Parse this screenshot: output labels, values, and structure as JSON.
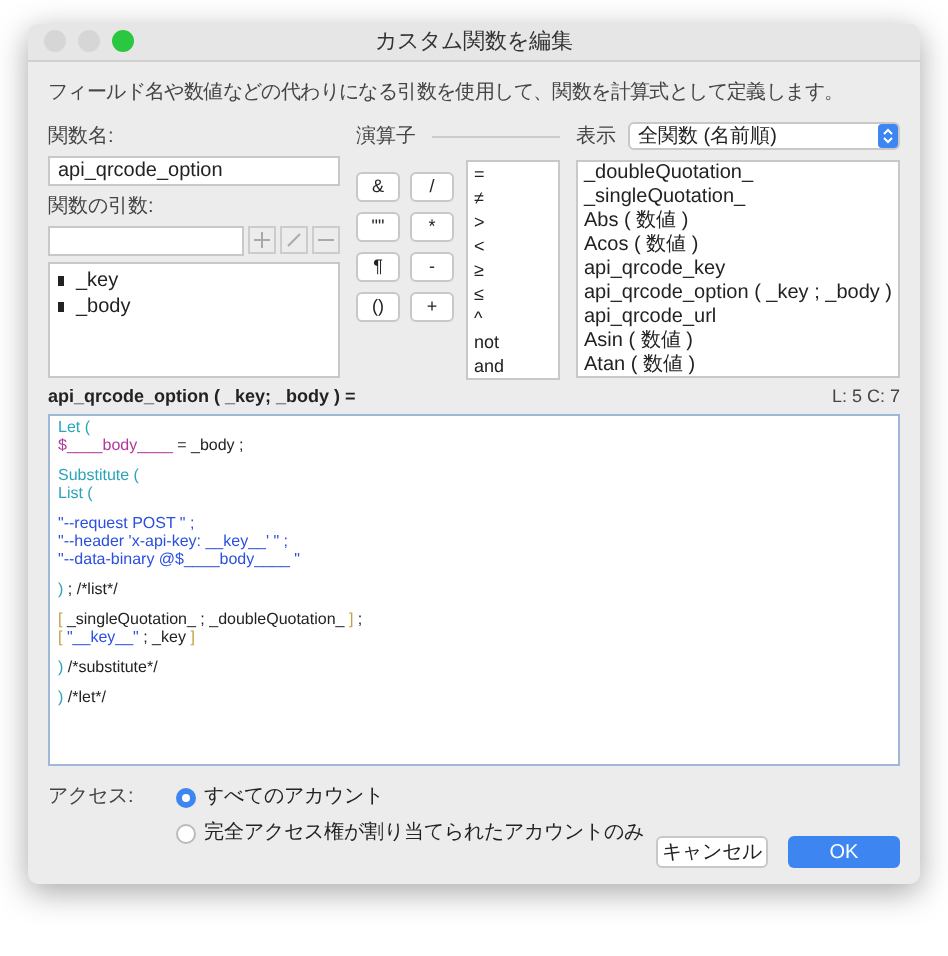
{
  "window": {
    "title": "カスタム関数を編集"
  },
  "description": "フィールド名や数値などの代わりになる引数を使用して、関数を計算式として定義します。",
  "function_name": {
    "label": "関数名:",
    "value": "api_qrcode_option"
  },
  "parameters": {
    "label": "関数の引数:",
    "items": [
      {
        "name": "_key"
      },
      {
        "name": "_body"
      }
    ]
  },
  "operators": {
    "label": "演算子",
    "buttons": [
      "&",
      "/",
      "\"\"",
      "*",
      "¶",
      "-",
      "()",
      "+"
    ],
    "list": [
      "=",
      "≠",
      ">",
      "<",
      "≥",
      "≤",
      "^",
      "not",
      "and"
    ]
  },
  "functions": {
    "label": "表示",
    "filter": "全関数 (名前順)",
    "items": [
      {
        "text": "_doubleQuotation_"
      },
      {
        "text": "_singleQuotation_"
      },
      {
        "text": "Abs ( 数値 )"
      },
      {
        "text": "Acos ( 数値 )"
      },
      {
        "text": "api_qrcode_key"
      },
      {
        "text": "api_qrcode_option ( _key ; _body )"
      },
      {
        "text": "api_qrcode_url"
      },
      {
        "text": "Asin ( 数値 )"
      },
      {
        "text": "Atan ( 数値 )"
      }
    ]
  },
  "editor": {
    "signature": "api_qrcode_option ( _key; _body ) =",
    "position": "L: 5 C: 7",
    "lines": [
      {
        "kind": "code",
        "tokens": [
          {
            "kind": "keyword",
            "text": "Let ("
          }
        ]
      },
      {
        "kind": "code",
        "tokens": [
          {
            "kind": "variable",
            "text": "$____body____"
          },
          {
            "kind": "plain",
            "text": " = _body ;"
          }
        ]
      },
      {
        "kind": "blank"
      },
      {
        "kind": "code",
        "tokens": [
          {
            "kind": "keyword",
            "text": "Substitute ("
          }
        ]
      },
      {
        "kind": "code",
        "tokens": [
          {
            "kind": "keyword",
            "text": "List ("
          }
        ]
      },
      {
        "kind": "blank"
      },
      {
        "kind": "code",
        "tokens": [
          {
            "kind": "string",
            "text": "\"--request POST \" ;"
          }
        ]
      },
      {
        "kind": "code",
        "tokens": [
          {
            "kind": "string",
            "text": "\"--header 'x-api-key: __key__' \" ;"
          }
        ]
      },
      {
        "kind": "code",
        "tokens": [
          {
            "kind": "string",
            "text": "\"--data-binary @$____body____ \""
          }
        ]
      },
      {
        "kind": "blank"
      },
      {
        "kind": "code",
        "tokens": [
          {
            "kind": "keyword",
            "text": ")"
          },
          {
            "kind": "plain",
            "text": " ; /*list*/"
          }
        ]
      },
      {
        "kind": "blank"
      },
      {
        "kind": "code",
        "tokens": [
          {
            "kind": "bracket",
            "text": "["
          },
          {
            "kind": "plain",
            "text": " _singleQuotation_ ; _doubleQuotation_ "
          },
          {
            "kind": "bracket",
            "text": "]"
          },
          {
            "kind": "plain",
            "text": " ;"
          }
        ]
      },
      {
        "kind": "code",
        "tokens": [
          {
            "kind": "bracket",
            "text": "["
          },
          {
            "kind": "string",
            "text": " \"__key__\""
          },
          {
            "kind": "plain",
            "text": " ; _key "
          },
          {
            "kind": "bracket",
            "text": "]"
          }
        ]
      },
      {
        "kind": "blank"
      },
      {
        "kind": "code",
        "tokens": [
          {
            "kind": "keyword",
            "text": ")"
          },
          {
            "kind": "plain",
            "text": " /*substitute*/"
          }
        ]
      },
      {
        "kind": "blank"
      },
      {
        "kind": "code",
        "tokens": [
          {
            "kind": "keyword",
            "text": ")"
          },
          {
            "kind": "plain",
            "text": " /*let*/"
          }
        ]
      }
    ]
  },
  "access": {
    "label": "アクセス:",
    "options": [
      {
        "label": "すべてのアカウント",
        "selected": true
      },
      {
        "label": "完全アクセス権が割り当てられたアカウントのみ",
        "selected": false
      }
    ]
  },
  "buttons": [
    {
      "label": "キャンセル",
      "kind": "secondary"
    },
    {
      "label": "OK",
      "kind": "primary"
    }
  ]
}
